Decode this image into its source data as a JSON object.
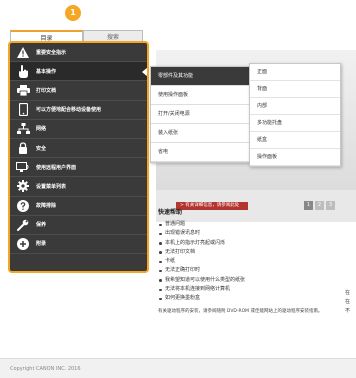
{
  "tabs": {
    "toc": "目录",
    "search": "搜索"
  },
  "badge": "1",
  "nav": [
    {
      "label": "重要安全指示",
      "icon": "warning-icon"
    },
    {
      "label": "基本操作",
      "icon": "hand-pointer-icon"
    },
    {
      "label": "打印文档",
      "icon": "printer-icon"
    },
    {
      "label": "可以方便地配合移动设备使用",
      "icon": "mobile-device-icon"
    },
    {
      "label": "网络",
      "icon": "network-icon"
    },
    {
      "label": "安全",
      "icon": "lock-icon"
    },
    {
      "label": "使用远程用户界面",
      "icon": "remote-ui-icon"
    },
    {
      "label": "设置菜单列表",
      "icon": "gear-icon"
    },
    {
      "label": "故障排除",
      "icon": "question-icon"
    },
    {
      "label": "保养",
      "icon": "wrench-icon"
    },
    {
      "label": "附录",
      "icon": "plus-icon"
    }
  ],
  "submenu1": [
    "零部件及其功能",
    "使用操作面板",
    "打开/关闭电源",
    "装入纸张",
    "省电"
  ],
  "submenu2": [
    "正面",
    "背面",
    "内部",
    "多功能托盘",
    "纸盒",
    "操作面板"
  ],
  "banner": {
    "caption": "> 有关详细信息，请参阅此处",
    "pages": [
      "1",
      "2",
      "3"
    ]
  },
  "help": {
    "title": "快速帮助",
    "items": [
      "普通问题",
      "出现错误讯息时",
      "本机上的指示灯亮起或闪烁",
      "无法打印文档",
      "卡纸",
      "无法正确打印时",
      "我希望知道可以使用什么类型的纸张",
      "无法将本机连接到网络计算机",
      "如何更换墨粉盒"
    ],
    "note": "有关驱动程序的安装，请参阅随附 DVD-ROM 或佳能网站上的驱动程序安装指南。"
  },
  "right_fragment": [
    "在",
    "在",
    "不"
  ],
  "footer": "Copyright CANON INC. 2016",
  "colors": {
    "accent": "#f5a623",
    "nav_bg": "#3a3a3a",
    "banner_bar": "#b3352f"
  }
}
